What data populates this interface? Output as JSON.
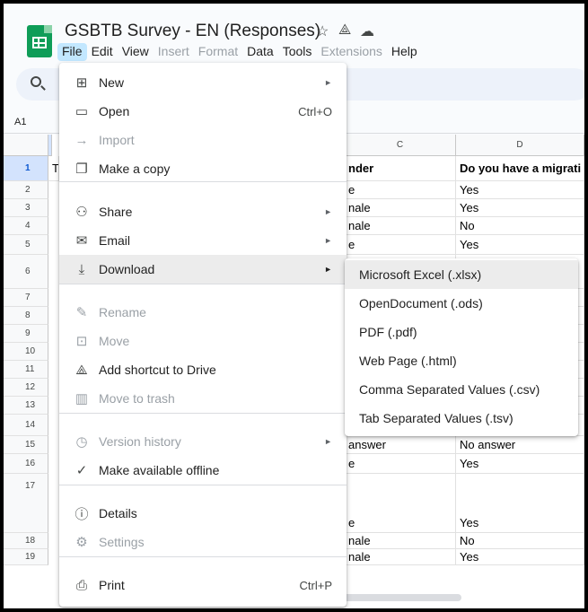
{
  "app": {
    "title": "GSBTB Survey - EN (Responses)",
    "star_icon": "star-outline-icon",
    "drive_icon": "add-to-drive-icon",
    "cloud_icon": "cloud-saved-icon"
  },
  "menubar": [
    "File",
    "Edit",
    "View",
    "Insert",
    "Format",
    "Data",
    "Tools",
    "Extensions",
    "Help"
  ],
  "formula_bar": {
    "cell_ref": "A1"
  },
  "grid": {
    "columns": [
      "C",
      "D"
    ],
    "rows": [
      {
        "num": "1",
        "c": "nder",
        "d": "Do you have a migrati",
        "bold": true,
        "first": "T"
      },
      {
        "num": "2",
        "c": "e",
        "d": "Yes"
      },
      {
        "num": "3",
        "c": "nale",
        "d": "Yes"
      },
      {
        "num": "4",
        "c": "nale",
        "d": "No"
      },
      {
        "num": "5",
        "c": "e",
        "d": "Yes"
      },
      {
        "num": "6",
        "c": "",
        "d": ""
      },
      {
        "num": "7",
        "c": "",
        "d": ""
      },
      {
        "num": "8",
        "c": "",
        "d": ""
      },
      {
        "num": "9",
        "c": "",
        "d": ""
      },
      {
        "num": "10",
        "c": "",
        "d": ""
      },
      {
        "num": "11",
        "c": "",
        "d": ""
      },
      {
        "num": "12",
        "c": "",
        "d": ""
      },
      {
        "num": "13",
        "c": "",
        "d": ""
      },
      {
        "num": "14",
        "c": "",
        "d": ""
      },
      {
        "num": "15",
        "c": "answer",
        "d": "No answer"
      },
      {
        "num": "16",
        "c": "e",
        "d": "Yes"
      },
      {
        "num": "17",
        "c": "e",
        "d": "Yes"
      },
      {
        "num": "18",
        "c": "nale",
        "d": "No"
      },
      {
        "num": "19",
        "c": "nale",
        "d": "Yes"
      }
    ]
  },
  "file_menu": {
    "items": [
      {
        "label": "New",
        "icon": "new-sheet-icon",
        "glyph": "⊞",
        "arrow": "►",
        "disabled": false
      },
      {
        "label": "Open",
        "icon": "folder-icon",
        "glyph": "▭",
        "shortcut": "Ctrl+O",
        "disabled": false
      },
      {
        "label": "Import",
        "icon": "import-icon",
        "glyph": "→",
        "disabled": true
      },
      {
        "label": "Make a copy",
        "icon": "copy-icon",
        "glyph": "❐",
        "disabled": false
      },
      {
        "label": "Share",
        "icon": "share-person-icon",
        "glyph": "⚇",
        "arrow": "►",
        "disabled": false
      },
      {
        "label": "Email",
        "icon": "email-icon",
        "glyph": "✉",
        "arrow": "►",
        "disabled": false
      },
      {
        "label": "Download",
        "icon": "download-icon",
        "glyph": "⤓",
        "arrow": "►",
        "disabled": false,
        "hover": true
      },
      {
        "label": "Rename",
        "icon": "rename-pencil-icon",
        "glyph": "✎",
        "disabled": true
      },
      {
        "label": "Move",
        "icon": "move-folder-icon",
        "glyph": "⊡",
        "disabled": true
      },
      {
        "label": "Add shortcut to Drive",
        "icon": "drive-shortcut-icon",
        "glyph": "⟁",
        "disabled": false
      },
      {
        "label": "Move to trash",
        "icon": "trash-icon",
        "glyph": "▥",
        "disabled": true
      },
      {
        "label": "Version history",
        "icon": "history-icon",
        "glyph": "◷",
        "arrow": "►",
        "disabled": true
      },
      {
        "label": "Make available offline",
        "icon": "offline-check-icon",
        "glyph": "✓",
        "disabled": false
      },
      {
        "label": "Details",
        "icon": "info-icon",
        "glyph": "ⓘ",
        "disabled": false
      },
      {
        "label": "Settings",
        "icon": "settings-gear-icon",
        "glyph": "⚙",
        "disabled": true
      },
      {
        "label": "Print",
        "icon": "print-icon",
        "glyph": "⎙",
        "shortcut": "Ctrl+P",
        "disabled": false
      }
    ]
  },
  "download_submenu": {
    "items": [
      {
        "label": "Microsoft Excel (.xlsx)",
        "hover": true
      },
      {
        "label": "OpenDocument (.ods)"
      },
      {
        "label": "PDF (.pdf)"
      },
      {
        "label": "Web Page (.html)"
      },
      {
        "label": "Comma Separated Values (.csv)"
      },
      {
        "label": "Tab Separated Values (.tsv)"
      }
    ]
  }
}
